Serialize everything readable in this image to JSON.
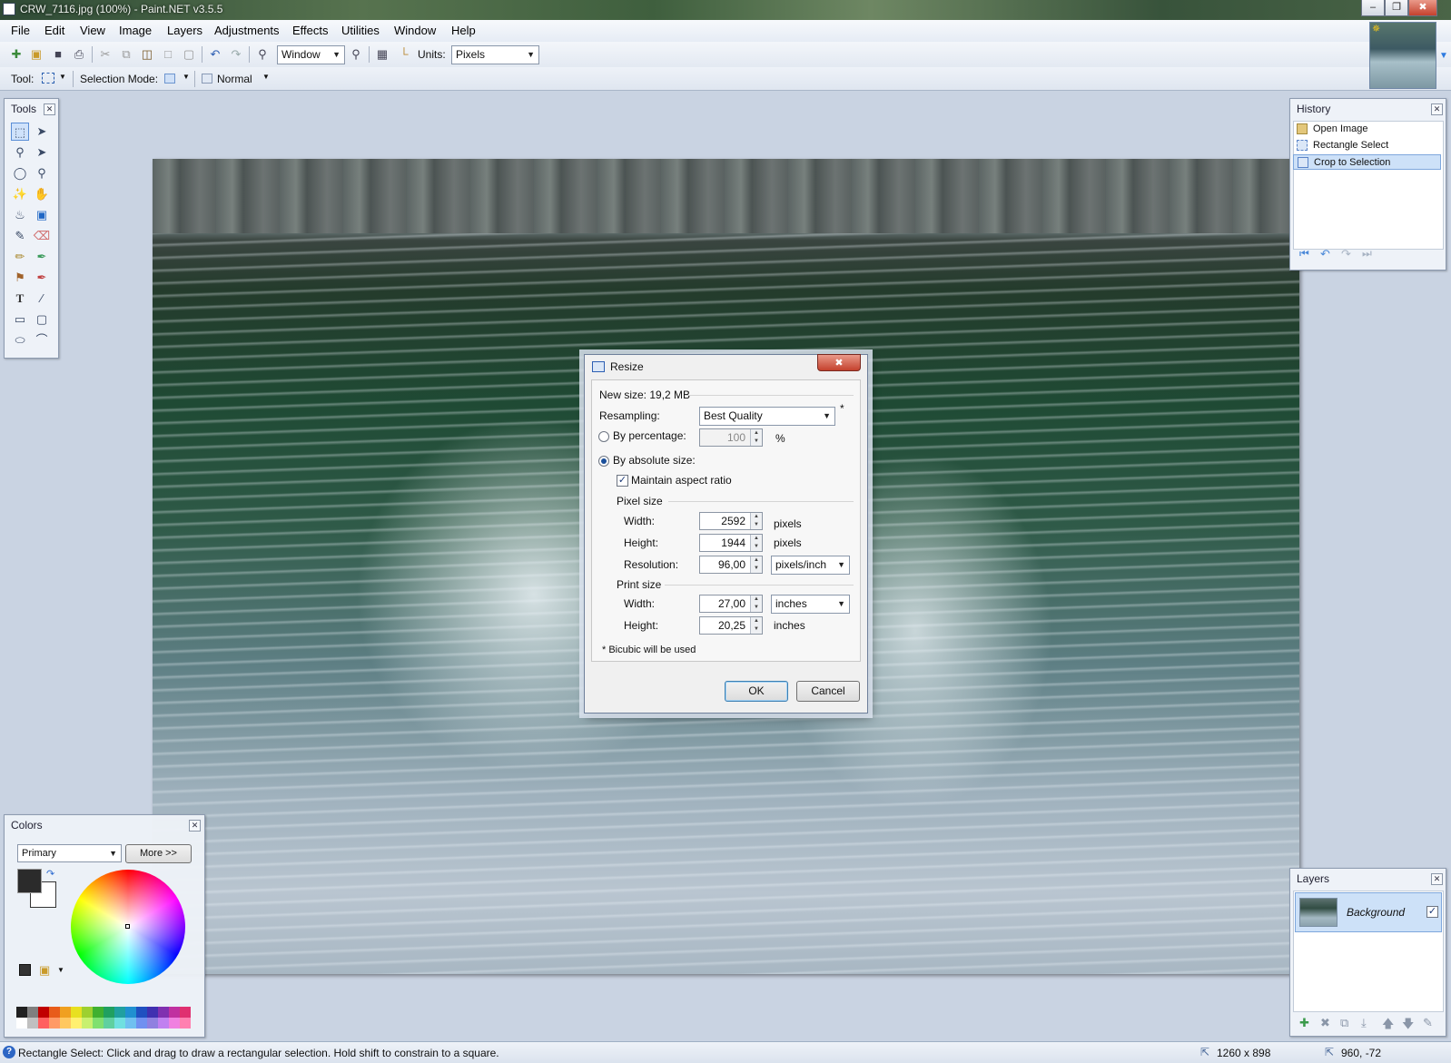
{
  "window": {
    "title": "CRW_7116.jpg (100%) - Paint.NET v3.5.5",
    "min": "–",
    "restore": "❐",
    "close": "✖"
  },
  "menu": [
    "File",
    "Edit",
    "View",
    "Image",
    "Layers",
    "Adjustments",
    "Effects",
    "Utilities",
    "Window",
    "Help"
  ],
  "toolbar": {
    "zoom_value": "Window",
    "units_label": "Units:",
    "units_value": "Pixels"
  },
  "toolbar2": {
    "tool_label": "Tool:",
    "selection_mode_label": "Selection Mode:",
    "blend_value": "Normal"
  },
  "tools_panel": {
    "title": "Tools"
  },
  "history_panel": {
    "title": "History",
    "items": [
      "Open Image",
      "Rectangle Select",
      "Crop to Selection"
    ],
    "selected_index": 2
  },
  "layers_panel": {
    "title": "Layers",
    "layer_name": "Background"
  },
  "colors_panel": {
    "title": "Colors",
    "mode": "Primary",
    "more_button": "More >>",
    "primary_color": "#2b2b2b",
    "secondary_color": "#ffffff",
    "palette": [
      "#202020",
      "#7f7f7f",
      "#c00000",
      "#e85c1a",
      "#f0a020",
      "#e8e020",
      "#9ed030",
      "#40b030",
      "#20a060",
      "#20a0a0",
      "#2090d0",
      "#2050c0",
      "#4030b0",
      "#8030b0",
      "#c030a0",
      "#e03070",
      "#ffffff",
      "#c0c0c0",
      "#ff6060",
      "#ff9a66",
      "#ffc860",
      "#fff070",
      "#c8f070",
      "#80e070",
      "#60d0a0",
      "#70e0e0",
      "#70c0f0",
      "#7090f0",
      "#9080e0",
      "#c080f0",
      "#f080e0",
      "#ff80b0"
    ]
  },
  "dialog": {
    "title": "Resize",
    "close": "✖",
    "new_size": "New size: 19,2 MB",
    "resampling_label": "Resampling:",
    "resampling_value": "Best Quality",
    "asterisk": "*",
    "by_percentage": "By percentage:",
    "percentage_value": "100",
    "percent_sign": "%",
    "by_absolute": "By absolute size:",
    "maintain_aspect": "Maintain aspect ratio",
    "pixel_size": "Pixel size",
    "width_label": "Width:",
    "width_value": "2592",
    "width_unit": "pixels",
    "height_label": "Height:",
    "height_value": "1944",
    "height_unit": "pixels",
    "resolution_label": "Resolution:",
    "resolution_value": "96,00",
    "resolution_unit": "pixels/inch",
    "print_size": "Print size",
    "print_width_label": "Width:",
    "print_width_value": "27,00",
    "print_width_unit": "inches",
    "print_height_label": "Height:",
    "print_height_value": "20,25",
    "print_height_unit": "inches",
    "footnote": "* Bicubic will be used",
    "ok": "OK",
    "cancel": "Cancel"
  },
  "status": {
    "message": "Rectangle Select: Click and drag to draw a rectangular selection. Hold shift to constrain to a square.",
    "image_size": "1260 x 898",
    "cursor_pos": "960, -72"
  }
}
